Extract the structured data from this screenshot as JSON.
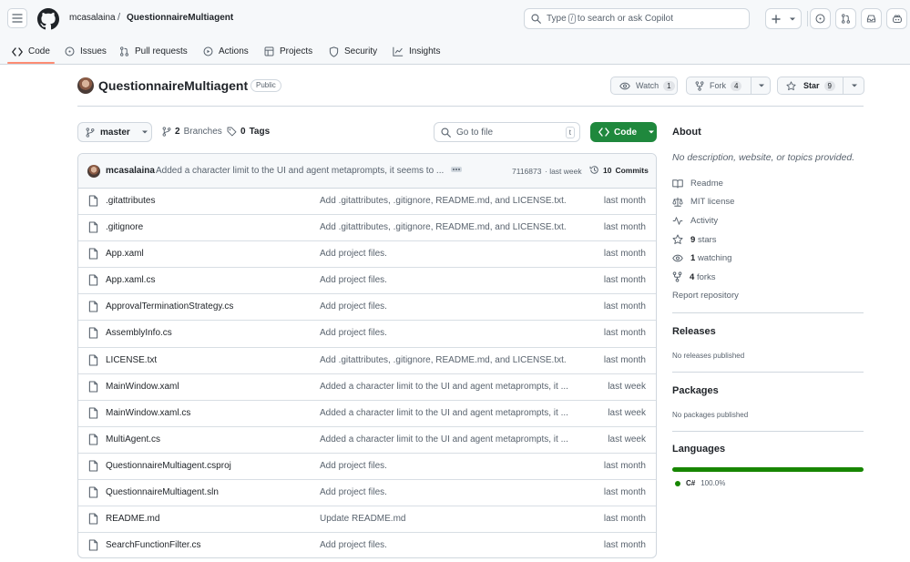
{
  "header": {
    "owner": "mcasalaina",
    "separator": "/",
    "repo": "QuestionnaireMultiagent",
    "search_prefix": "Type",
    "search_key": "/",
    "search_suffix": "to search or ask Copilot"
  },
  "nav": {
    "tabs": [
      {
        "label": "Code",
        "icon": "code-icon"
      },
      {
        "label": "Issues",
        "icon": "issue-icon"
      },
      {
        "label": "Pull requests",
        "icon": "pull-request-icon"
      },
      {
        "label": "Actions",
        "icon": "play-icon"
      },
      {
        "label": "Projects",
        "icon": "table-icon"
      },
      {
        "label": "Security",
        "icon": "shield-icon"
      },
      {
        "label": "Insights",
        "icon": "graph-icon"
      }
    ],
    "active_tab": "Code"
  },
  "repo": {
    "title": "QuestionnaireMultiagent",
    "visibility": "Public",
    "watch_label": "Watch",
    "watch_count": "1",
    "fork_label": "Fork",
    "fork_count": "4",
    "star_label": "Star",
    "star_count": "9"
  },
  "controls": {
    "branch": "master",
    "branches_count": "2",
    "branches_label": "Branches",
    "tags_count": "0",
    "tags_label": "Tags",
    "goto_placeholder": "Go to file",
    "goto_key": "t",
    "code_button": "Code"
  },
  "commit": {
    "author": "mcasalaina",
    "message": "Added a character limit to the UI and agent metaprompts, it seems to ...",
    "hash": "7116873",
    "time": "· last week",
    "commits_count": "10",
    "commits_label": "Commits"
  },
  "files": [
    {
      "name": ".gitattributes",
      "message": "Add .gitattributes, .gitignore, README.md, and LICENSE.txt.",
      "date": "last month"
    },
    {
      "name": ".gitignore",
      "message": "Add .gitattributes, .gitignore, README.md, and LICENSE.txt.",
      "date": "last month"
    },
    {
      "name": "App.xaml",
      "message": "Add project files.",
      "date": "last month"
    },
    {
      "name": "App.xaml.cs",
      "message": "Add project files.",
      "date": "last month"
    },
    {
      "name": "ApprovalTerminationStrategy.cs",
      "message": "Add project files.",
      "date": "last month"
    },
    {
      "name": "AssemblyInfo.cs",
      "message": "Add project files.",
      "date": "last month"
    },
    {
      "name": "LICENSE.txt",
      "message": "Add .gitattributes, .gitignore, README.md, and LICENSE.txt.",
      "date": "last month"
    },
    {
      "name": "MainWindow.xaml",
      "message": "Added a character limit to the UI and agent metaprompts, it ...",
      "date": "last week"
    },
    {
      "name": "MainWindow.xaml.cs",
      "message": "Added a character limit to the UI and agent metaprompts, it ...",
      "date": "last week"
    },
    {
      "name": "MultiAgent.cs",
      "message": "Added a character limit to the UI and agent metaprompts, it ...",
      "date": "last week"
    },
    {
      "name": "QuestionnaireMultiagent.csproj",
      "message": "Add project files.",
      "date": "last month"
    },
    {
      "name": "QuestionnaireMultiagent.sln",
      "message": "Add project files.",
      "date": "last month"
    },
    {
      "name": "README.md",
      "message": "Update README.md",
      "date": "last month"
    },
    {
      "name": "SearchFunctionFilter.cs",
      "message": "Add project files.",
      "date": "last month"
    }
  ],
  "about": {
    "heading": "About",
    "description": "No description, website, or topics provided.",
    "readme": "Readme",
    "license": "MIT license",
    "activity": "Activity",
    "stars_count": "9",
    "stars_label": "stars",
    "watching_count": "1",
    "watching_label": "watching",
    "forks_count": "4",
    "forks_label": "forks",
    "report": "Report repository"
  },
  "releases": {
    "heading": "Releases",
    "empty": "No releases published"
  },
  "packages": {
    "heading": "Packages",
    "empty": "No packages published"
  },
  "languages": {
    "heading": "Languages",
    "items": [
      {
        "name": "C#",
        "percent": "100.0%",
        "color": "#178600",
        "fraction": 1.0
      }
    ]
  },
  "colors": {
    "primary_button": "#1f883d",
    "active_tab_underline": "#fd8c73",
    "link": "#0969da"
  }
}
